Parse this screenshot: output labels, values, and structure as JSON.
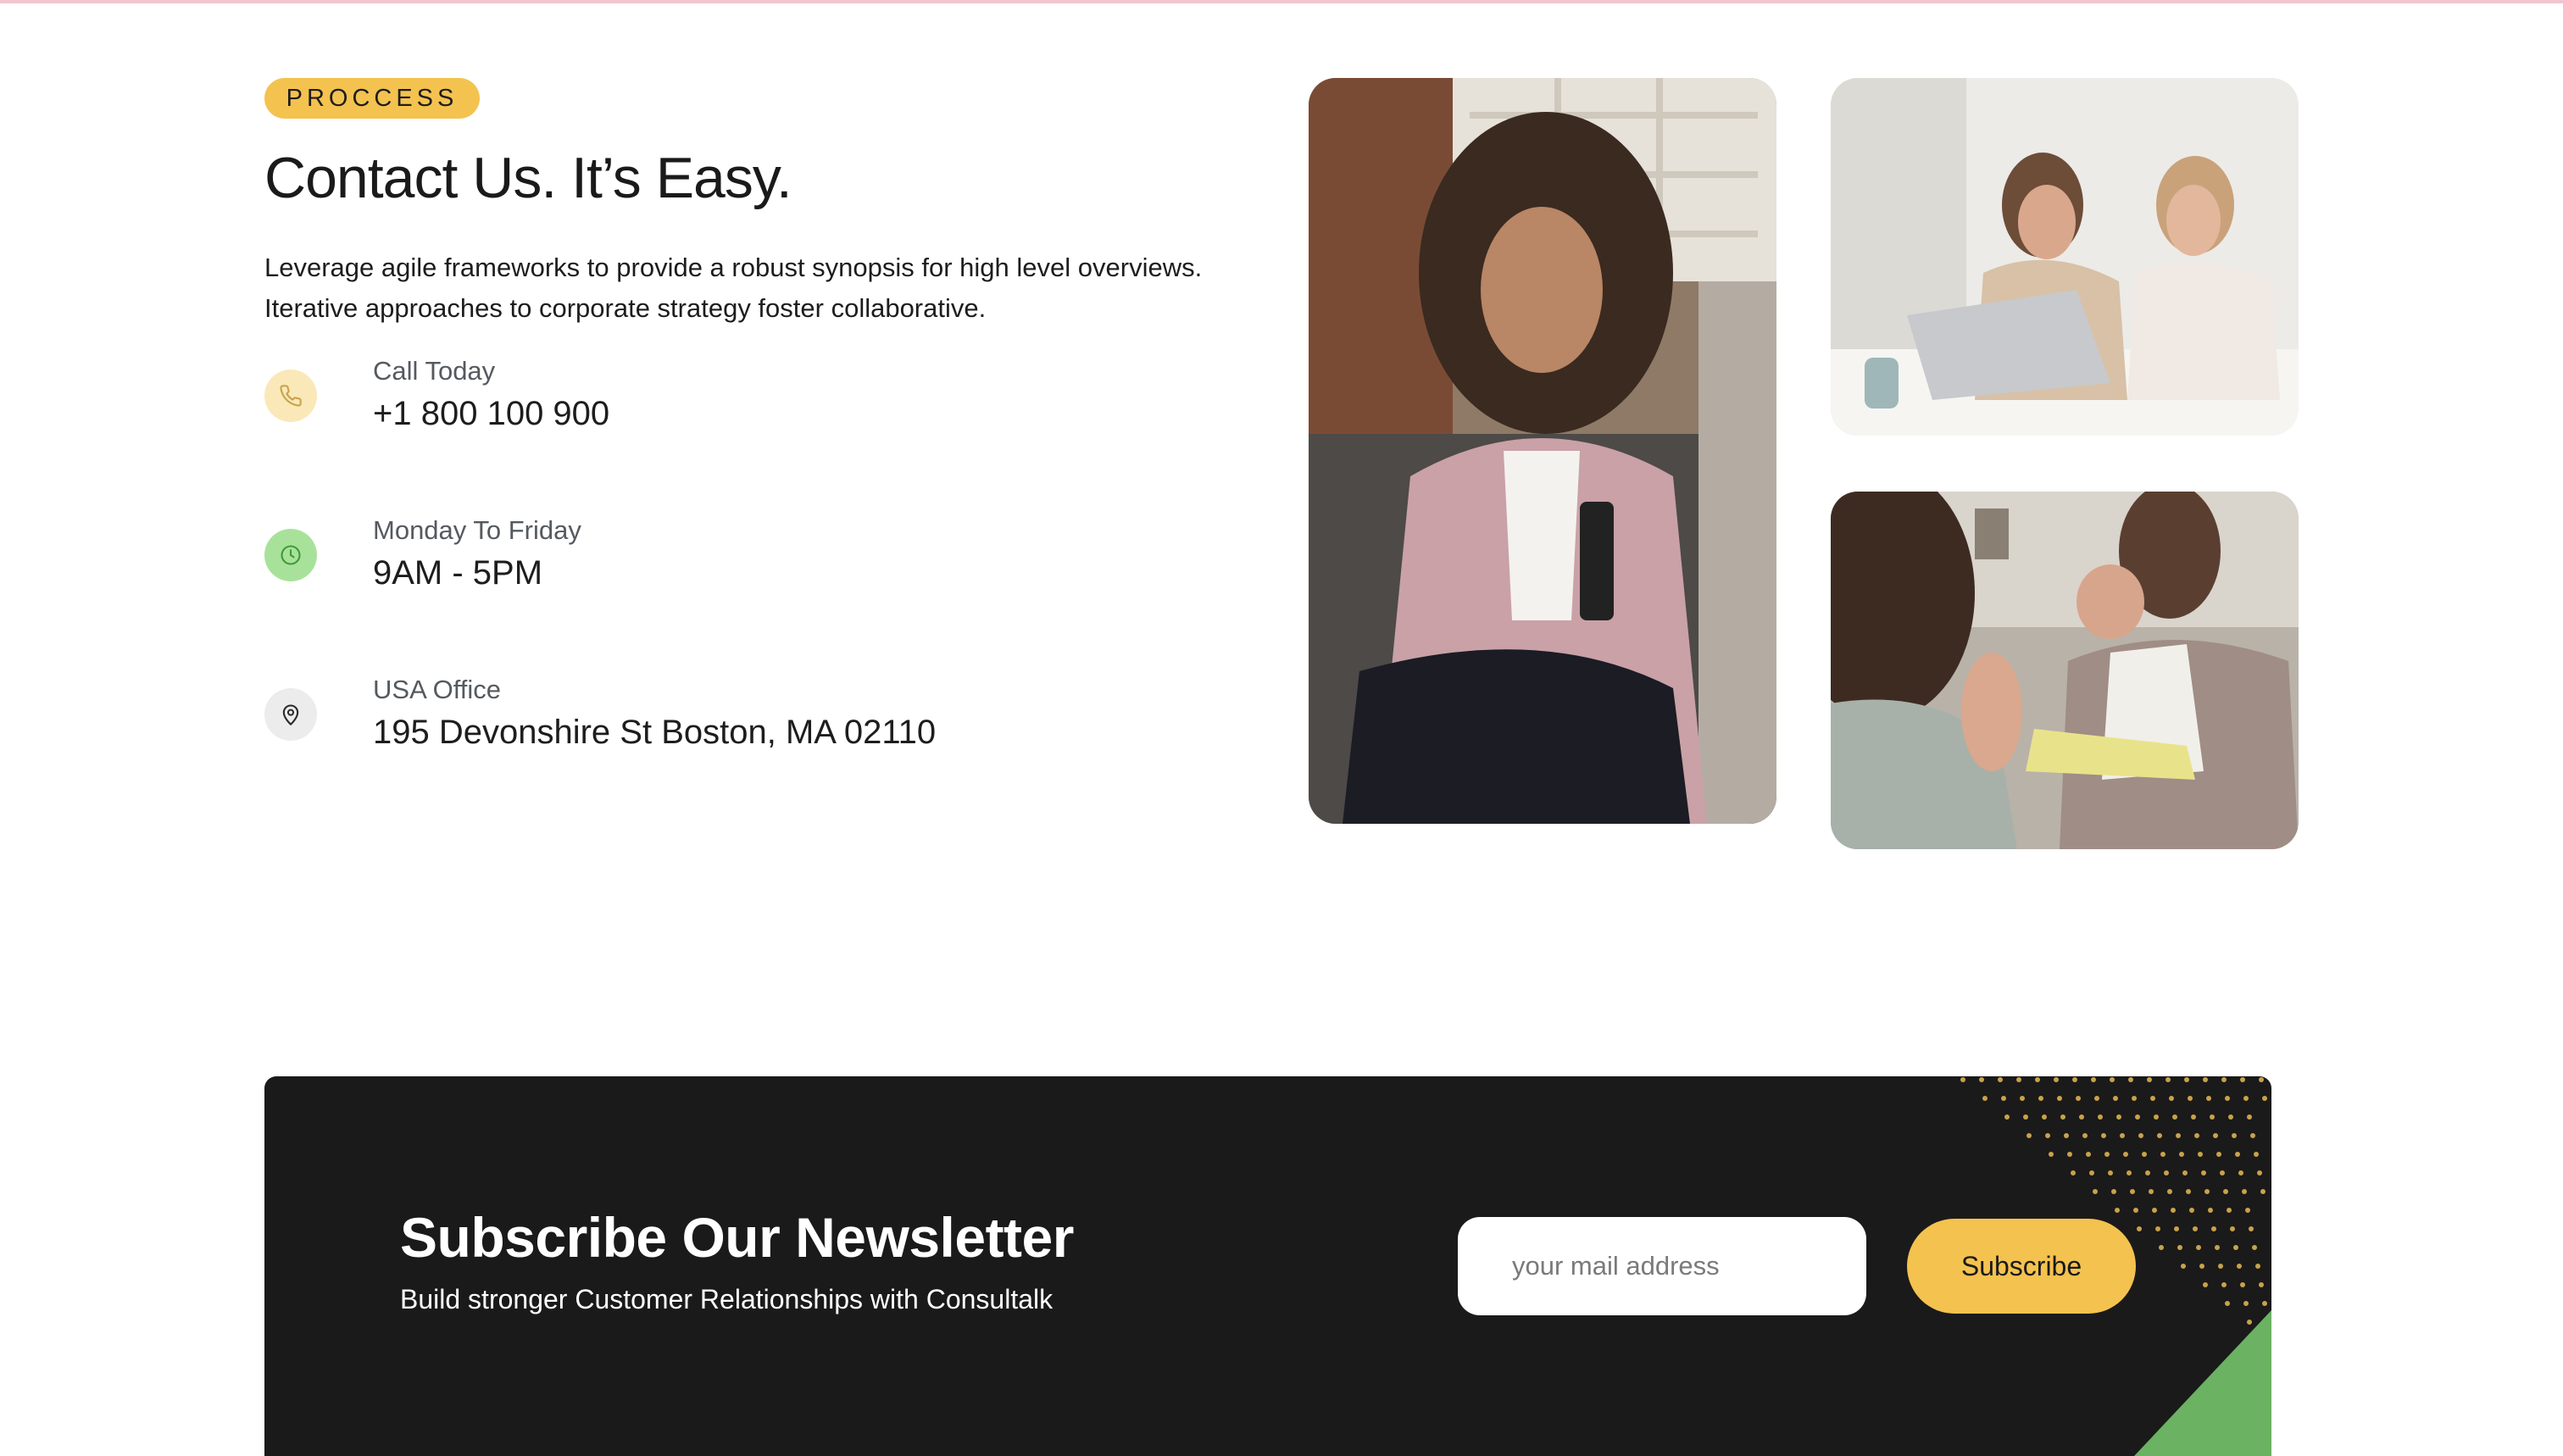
{
  "contact": {
    "badge": "PROCCESS",
    "heading": "Contact Us. It’s Easy.",
    "description": "Leverage agile frameworks to provide a robust synopsis for high level overviews. Iterative approaches to corporate strategy foster collaborative.",
    "items": [
      {
        "label": "Call Today",
        "value": "+1 800 100 900",
        "icon": "phone-icon",
        "icon_bg": "#fbe8b8",
        "icon_color": "#c9a24a"
      },
      {
        "label": "Monday To Friday",
        "value": "9AM - 5PM",
        "icon": "clock-icon",
        "icon_bg": "#a8e29a",
        "icon_color": "#3f9a3a"
      },
      {
        "label": "USA Office",
        "value": "195 Devonshire St Boston, MA 02110",
        "icon": "map-pin-icon",
        "icon_bg": "#ececec",
        "icon_color": "#2a2a2a"
      }
    ]
  },
  "newsletter": {
    "title": "Subscribe Our Newsletter",
    "subtitle": "Build stronger Customer Relationships with Consultalk",
    "input_placeholder": "your mail address",
    "button_label": "Subscribe"
  },
  "colors": {
    "accent_yellow": "#f4c24f",
    "dark": "#1a1a1a",
    "accent_green": "#6bb262"
  }
}
